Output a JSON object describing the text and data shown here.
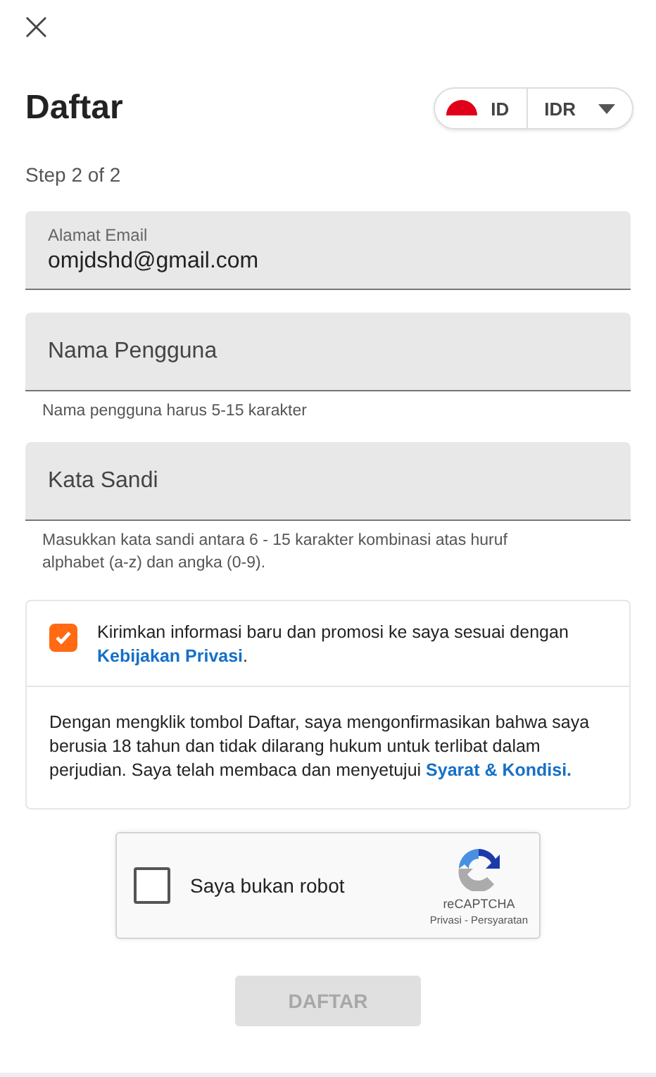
{
  "header": {
    "close": "×",
    "title": "Daftar",
    "language": "ID",
    "currency": "IDR"
  },
  "step": "Step 2 of 2",
  "fields": [
    {
      "label": "Alamat Email",
      "value": "omjdshd@gmail.com"
    },
    {
      "placeholder": "Nama Pengguna",
      "hint": "Nama pengguna harus 5-15 karakter"
    },
    {
      "placeholder": "Kata Sandi",
      "hint": "Masukkan kata sandi antara 6 - 15 karakter kombinasi atas huruf alphabet (a-z) dan angka (0-9)."
    }
  ],
  "consent": {
    "checked": true,
    "text": "Kirimkan informasi baru dan promosi ke saya sesuai dengan ",
    "link": "Kebijakan Privasi",
    "suffix": "."
  },
  "terms": {
    "text": "Dengan mengklik tombol Daftar, saya mengonfirmasikan bahwa saya berusia 18 tahun dan tidak dilarang hukum untuk terlibat dalam perjudian. Saya telah membaca dan menyetujui ",
    "link": "Syarat & Kondisi."
  },
  "captcha": {
    "checked": false,
    "label": "Saya bukan robot",
    "brand": "reCAPTCHA",
    "links": "Privasi - Persyaratan"
  },
  "submit": {
    "label": "DAFTAR",
    "disabled": true
  }
}
